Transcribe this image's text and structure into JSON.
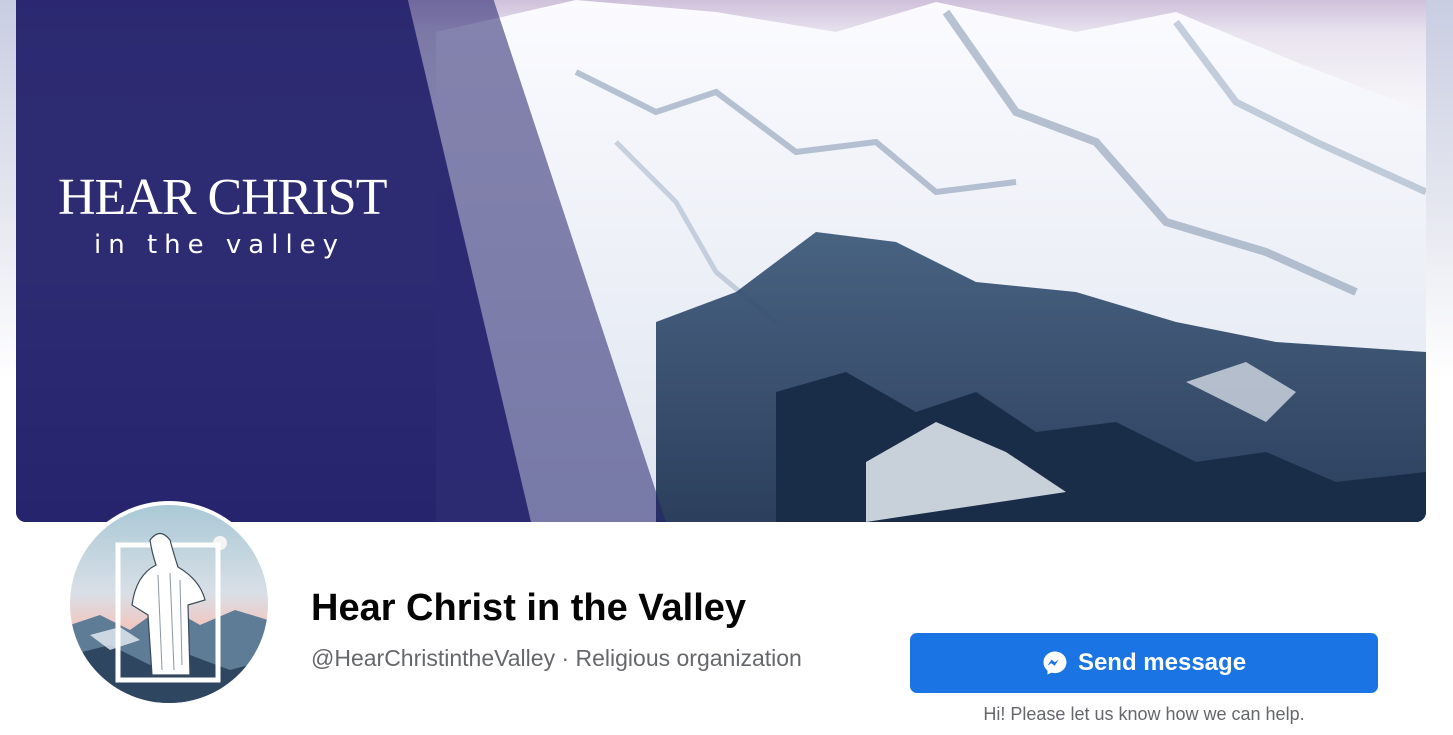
{
  "cover": {
    "logo_title": "HEAR CHRIST",
    "logo_subtitle": "in the valley",
    "overlay_color": "#23216b"
  },
  "profile": {
    "name": "Hear Christ in the Valley",
    "meta": "@HearChristintheValley · Religious organization"
  },
  "actions": {
    "send_message_label": "Send message",
    "send_message_icon": "messenger-icon",
    "help_text": "Hi! Please let us know how we can help."
  },
  "colors": {
    "primary_button": "#1b74e4",
    "name_text": "#050505",
    "secondary_text": "#65676b"
  }
}
